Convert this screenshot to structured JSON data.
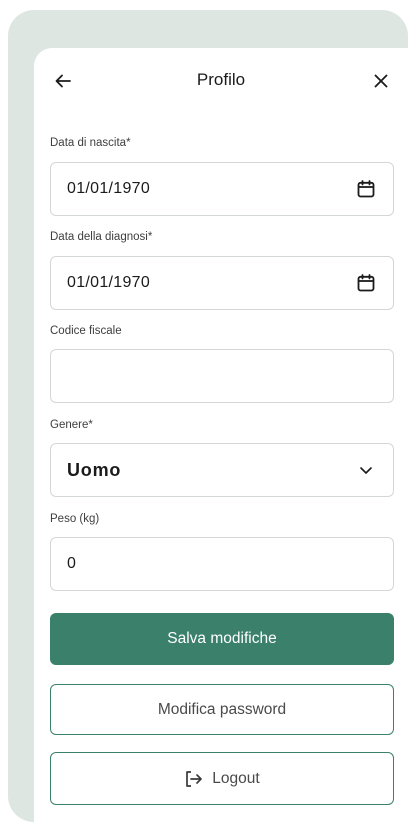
{
  "header": {
    "title": "Profilo",
    "back_icon": "arrow-left-icon",
    "close_icon": "close-icon"
  },
  "form": {
    "birth_date": {
      "label": "Data di nascita*",
      "value": "01/01/1970",
      "icon": "calendar-icon"
    },
    "diagnosis_date": {
      "label": "Data della diagnosi*",
      "value": "01/01/1970",
      "icon": "calendar-icon"
    },
    "tax_code": {
      "label": "Codice fiscale",
      "value": ""
    },
    "gender": {
      "label": "Genere*",
      "value": "Uomo",
      "icon": "chevron-down-icon"
    },
    "weight": {
      "label": "Peso (kg)",
      "value": "0"
    }
  },
  "actions": {
    "save_label": "Salva modifiche",
    "change_password_label": "Modifica password",
    "logout_label": "Logout",
    "logout_icon": "logout-icon"
  },
  "colors": {
    "accent": "#3a806b",
    "frame": "#dde6e1",
    "border": "#d3d7d5"
  }
}
